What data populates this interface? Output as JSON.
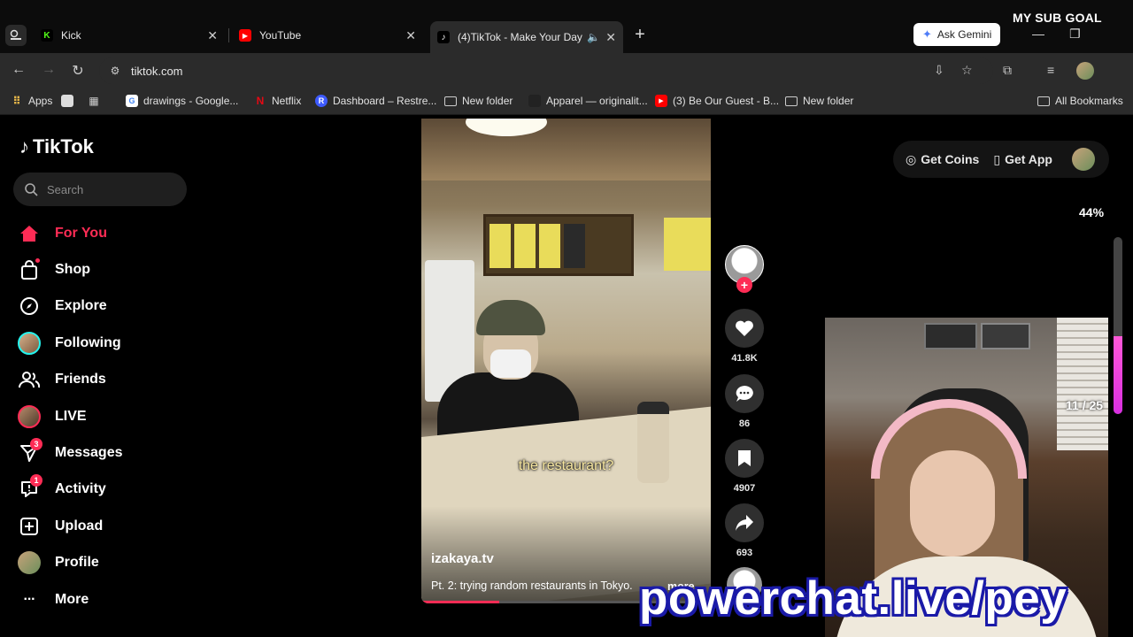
{
  "browser": {
    "tabs": [
      {
        "title": "Kick",
        "icon": "kick-icon",
        "color": "#53fc18"
      },
      {
        "title": "YouTube",
        "icon": "youtube-icon",
        "color": "#ff0000"
      },
      {
        "title": "(4)TikTok - Make Your Day",
        "icon": "tiktok-icon",
        "color": "#ffffff",
        "active": true,
        "audio": true
      }
    ],
    "ask_gemini": "Ask Gemini",
    "url": "tiktok.com",
    "bookmarks": [
      {
        "label": "Apps",
        "icon": "apps-grid-icon"
      },
      {
        "label": "drawings - Google...",
        "icon": "google-icon"
      },
      {
        "label": "Netflix",
        "icon": "netflix-icon"
      },
      {
        "label": "Dashboard – Restre...",
        "icon": "restream-icon"
      },
      {
        "label": "New folder",
        "icon": "folder-icon"
      },
      {
        "label": "Apparel — originalit...",
        "icon": "site-icon"
      },
      {
        "label": "(3) Be Our Guest - B...",
        "icon": "youtube-icon"
      },
      {
        "label": "New folder",
        "icon": "folder-icon"
      },
      {
        "label": "All Bookmarks",
        "icon": "folder-icon"
      }
    ]
  },
  "tiktok": {
    "logo": "TikTok",
    "search_placeholder": "Search",
    "nav": [
      {
        "label": "For You",
        "icon": "home-icon",
        "active": true
      },
      {
        "label": "Shop",
        "icon": "shop-bag-icon"
      },
      {
        "label": "Explore",
        "icon": "compass-icon"
      },
      {
        "label": "Following",
        "icon": "following-avatar"
      },
      {
        "label": "Friends",
        "icon": "friends-icon"
      },
      {
        "label": "LIVE",
        "icon": "live-avatar"
      },
      {
        "label": "Messages",
        "icon": "send-icon",
        "badge": "3"
      },
      {
        "label": "Activity",
        "icon": "activity-icon",
        "badge": "1"
      },
      {
        "label": "Upload",
        "icon": "upload-icon"
      },
      {
        "label": "Profile",
        "icon": "profile-avatar"
      },
      {
        "label": "More",
        "icon": "more-dots-icon"
      }
    ],
    "top_right": {
      "coins": "Get Coins",
      "app": "Get App"
    },
    "video": {
      "caption": "the restaurant?",
      "author": "izakaya.tv",
      "description": "Pt. 2: trying random restaurants in Tokyo.",
      "more": "more",
      "progress": 0.27
    },
    "actions": {
      "likes": "41.8K",
      "comments": "86",
      "saves": "4907",
      "shares": "693"
    }
  },
  "stream_overlay": {
    "sub_goal_title": "MY SUB GOAL",
    "sub_goal_percent": "44%",
    "sub_goal_fraction": 0.44,
    "sub_counter": "11 / 25",
    "promo": "powerchat.live/pey"
  },
  "colors": {
    "accent": "#fe2c55",
    "goal": "#e040e8"
  }
}
